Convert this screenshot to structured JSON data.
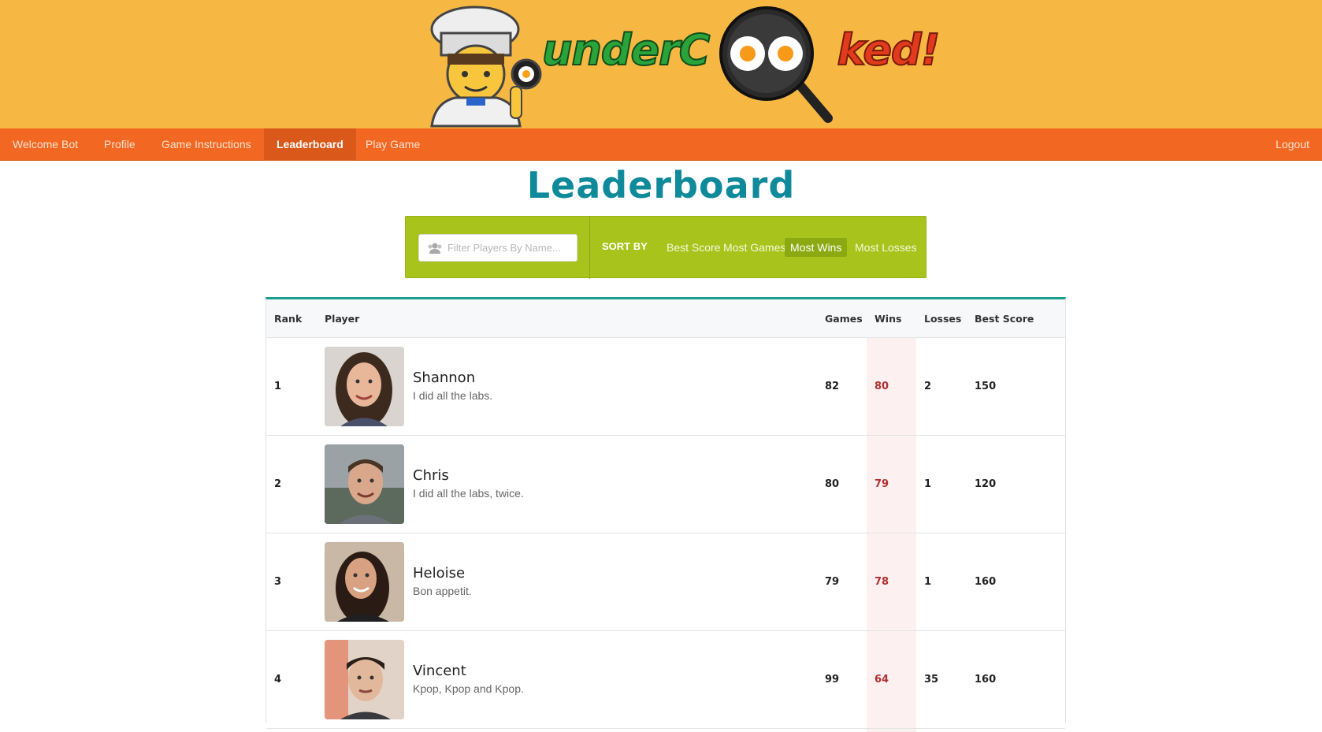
{
  "header": {
    "logo_text_green": "underC",
    "logo_text_red": "ked!",
    "logo_alt": "underCOOked!"
  },
  "nav": {
    "items": [
      {
        "label": "Welcome Bot"
      },
      {
        "label": "Profile"
      },
      {
        "label": "Game Instructions"
      },
      {
        "label": "Leaderboard",
        "active": true
      },
      {
        "label": "Play Game"
      }
    ],
    "logout": "Logout"
  },
  "page": {
    "title": "Leaderboard"
  },
  "toolbar": {
    "search_placeholder": "Filter Players By Name...",
    "sort_label": "SORT BY",
    "sort_options": [
      "Best Score",
      "Most Games",
      "Most Wins",
      "Most Losses"
    ],
    "active_sort": "Most Wins"
  },
  "table": {
    "columns": [
      "Rank",
      "Player",
      "Games",
      "Wins",
      "Losses",
      "Best Score"
    ],
    "rows": [
      {
        "rank": "1",
        "name": "Shannon",
        "bio": "I did all the labs.",
        "games": "82",
        "wins": "80",
        "losses": "2",
        "best_score": "150"
      },
      {
        "rank": "2",
        "name": "Chris",
        "bio": "I did all the labs, twice.",
        "games": "80",
        "wins": "79",
        "losses": "1",
        "best_score": "120"
      },
      {
        "rank": "3",
        "name": "Heloise",
        "bio": "Bon appetit.",
        "games": "79",
        "wins": "78",
        "losses": "1",
        "best_score": "160"
      },
      {
        "rank": "4",
        "name": "Vincent",
        "bio": "Kpop, Kpop and Kpop.",
        "games": "99",
        "wins": "64",
        "losses": "35",
        "best_score": "160"
      }
    ]
  },
  "colors": {
    "banner": "#f7b843",
    "nav": "#f26722",
    "title": "#0f8a9b",
    "toolbar": "#a8c31b",
    "table_accent": "#1b9e8e",
    "wins_text": "#b03030"
  }
}
